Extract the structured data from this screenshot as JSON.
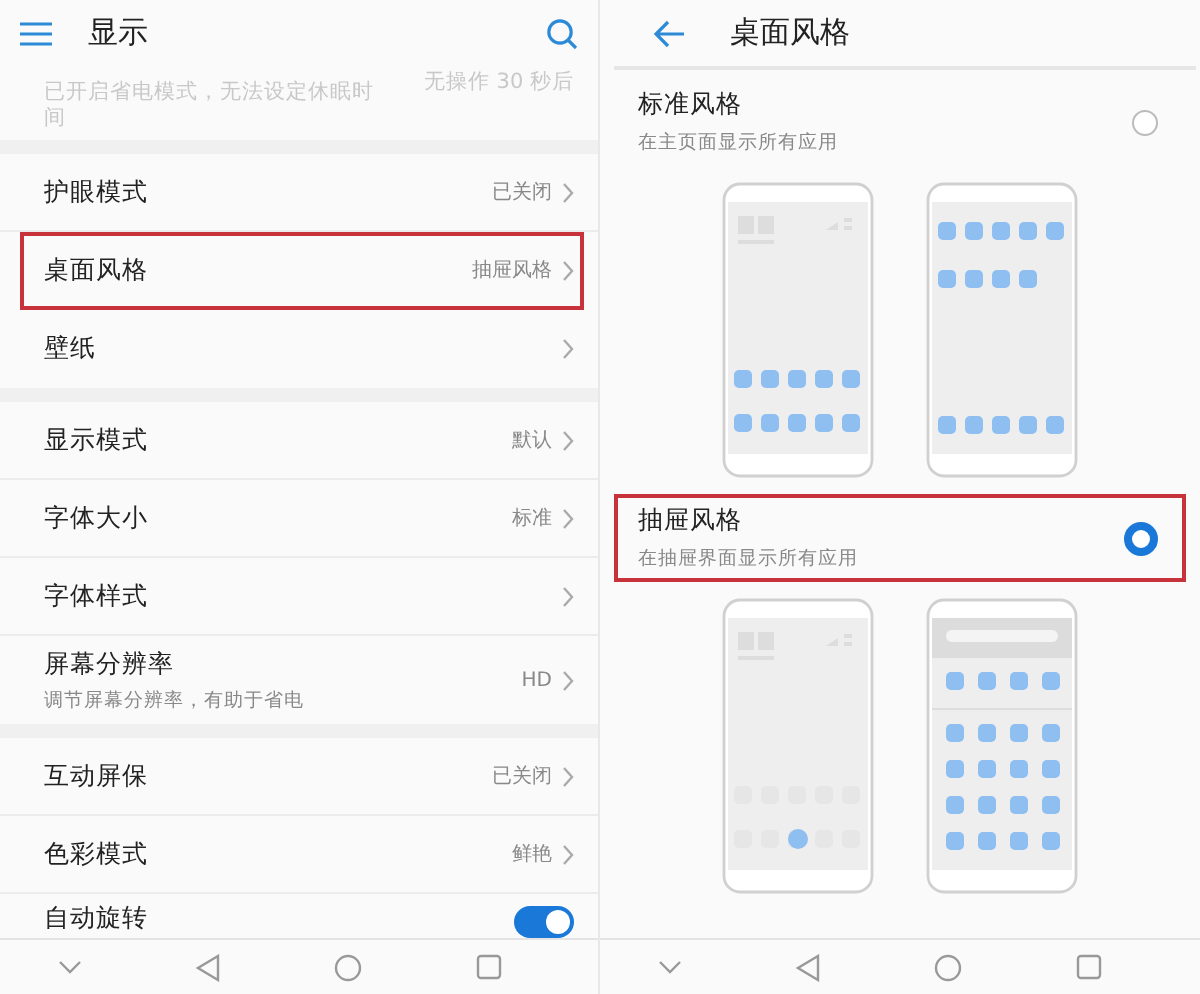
{
  "left": {
    "header": {
      "title": "显示"
    },
    "partial_row": {
      "text": "已开启省电模式，无法设定休眠时间",
      "value": "无操作 30 秒后"
    },
    "groups": [
      {
        "rows": [
          {
            "kind": "link",
            "label": "护眼模式",
            "value": "已关闭",
            "highlighted": false
          },
          {
            "kind": "link",
            "label": "桌面风格",
            "value": "抽屉风格",
            "highlighted": true
          },
          {
            "kind": "link",
            "label": "壁纸",
            "highlighted": false
          }
        ]
      },
      {
        "rows": [
          {
            "kind": "link",
            "label": "显示模式",
            "value": "默认",
            "highlighted": false
          },
          {
            "kind": "link",
            "label": "字体大小",
            "value": "标准",
            "highlighted": false
          },
          {
            "kind": "link",
            "label": "字体样式",
            "highlighted": false
          },
          {
            "kind": "link",
            "label": "屏幕分辨率",
            "subtitle": "调节屏幕分辨率，有助于省电",
            "value": "HD",
            "highlighted": false
          }
        ]
      },
      {
        "rows": [
          {
            "kind": "link",
            "label": "互动屏保",
            "value": "已关闭",
            "highlighted": false
          },
          {
            "kind": "link",
            "label": "色彩模式",
            "value": "鲜艳",
            "highlighted": false
          },
          {
            "kind": "toggle",
            "label": "自动旋转",
            "on": true,
            "highlighted": false
          }
        ]
      }
    ]
  },
  "right": {
    "header": {
      "title": "桌面风格"
    },
    "options": [
      {
        "title": "标准风格",
        "subtitle": "在主页面显示所有应用",
        "selected": false,
        "highlighted": false,
        "previews": [
          {
            "kind": "home"
          },
          {
            "kind": "apps"
          }
        ]
      },
      {
        "title": "抽屉风格",
        "subtitle": "在抽屉界面显示所有应用",
        "selected": true,
        "highlighted": true,
        "previews": [
          {
            "kind": "drawer-home"
          },
          {
            "kind": "drawer"
          }
        ]
      }
    ]
  }
}
